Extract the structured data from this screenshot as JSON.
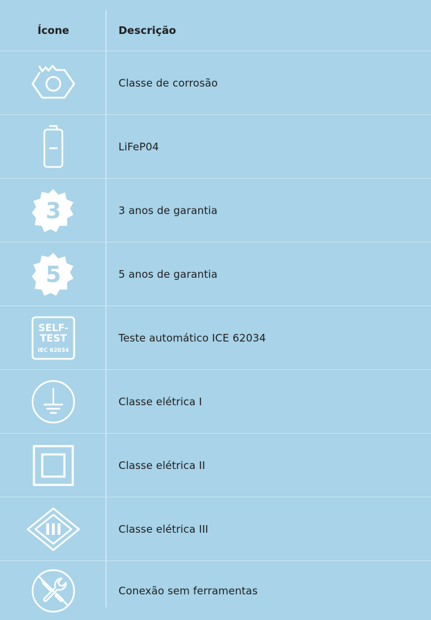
{
  "header": {
    "icon_col": "Ícone",
    "desc_col": "Descrição"
  },
  "rows": [
    {
      "icon": "corrosion-nut-icon",
      "label": "Classe de corrosão"
    },
    {
      "icon": "battery-icon",
      "label": "LiFeP04"
    },
    {
      "icon": "warranty-3-badge-icon",
      "label": "3 anos de garantia",
      "badge": "3"
    },
    {
      "icon": "warranty-5-badge-icon",
      "label": "5 anos de garantia",
      "badge": "5"
    },
    {
      "icon": "self-test-icon",
      "label": "Teste automático ICE 62034",
      "badge_lines": [
        "SELF-",
        "TEST",
        "IEC 62034"
      ]
    },
    {
      "icon": "electrical-class-1-ground-icon",
      "label": "Classe elétrica I"
    },
    {
      "icon": "electrical-class-2-double-square-icon",
      "label": "Classe elétrica II"
    },
    {
      "icon": "electrical-class-3-diamond-icon",
      "label": "Classe elétrica III",
      "badge": "III"
    },
    {
      "icon": "tool-free-connection-icon",
      "label": "Conexão sem ferramentas"
    }
  ],
  "colors": {
    "background": "#a8d3e8",
    "lines": "#cbe5f2",
    "icon": "#ffffff",
    "text": "#1e1e1e"
  }
}
